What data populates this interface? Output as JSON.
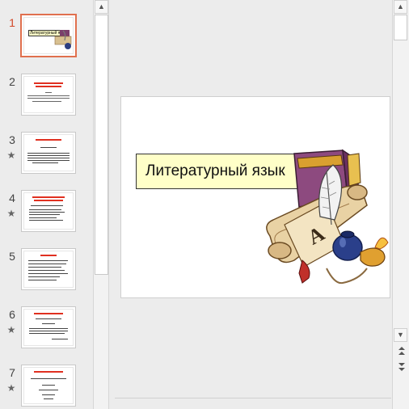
{
  "thumbnails": [
    {
      "number": "1",
      "active": true,
      "star": false
    },
    {
      "number": "2",
      "active": false,
      "star": false
    },
    {
      "number": "3",
      "active": false,
      "star": true
    },
    {
      "number": "4",
      "active": false,
      "star": true
    },
    {
      "number": "5",
      "active": false,
      "star": false
    },
    {
      "number": "6",
      "active": false,
      "star": true
    },
    {
      "number": "7",
      "active": false,
      "star": true
    }
  ],
  "star_glyph": "★",
  "thumb1_title": "Литературный язык",
  "slide": {
    "title": "Литературный язык"
  },
  "icons": {
    "scroll_up": "▲",
    "scroll_down": "▼",
    "prev_slide": "▲▲",
    "next_slide": "▼▼"
  },
  "colors": {
    "active_accent": "#e0704e",
    "title_fill": "#ffffc8",
    "thumb_red_text": "#e03020"
  }
}
